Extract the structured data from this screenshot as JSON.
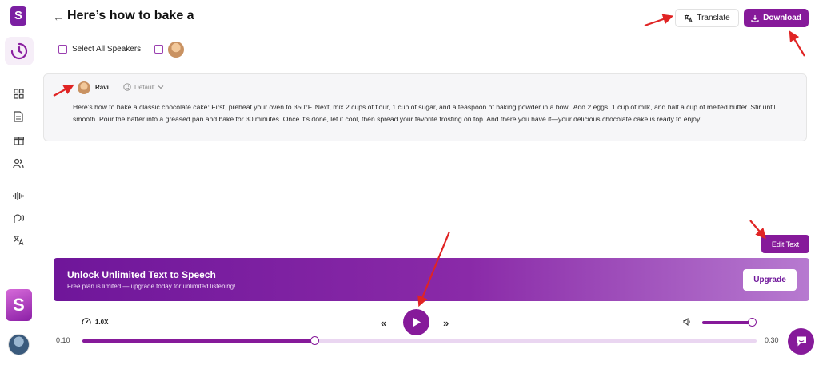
{
  "header": {
    "title": "Here’s how to bake a",
    "translate_label": "Translate",
    "download_label": "Download"
  },
  "speakers": {
    "select_all_label": "Select All Speakers"
  },
  "card": {
    "speaker_name": "Ravi",
    "voice_label": "Default",
    "text": "Here’s how to bake a classic chocolate cake: First, preheat your oven to 350°F. Next, mix 2 cups of flour, 1 cup of sugar, and a teaspoon of baking powder in a bowl. Add 2 eggs, 1 cup of milk, and half a cup of melted butter. Stir until smooth. Pour the batter into a greased pan and bake for 30 minutes. Once it’s done, let it cool, then spread your favorite frosting on top. And there you have it—your delicious chocolate cake is ready to enjoy!"
  },
  "edit_text_label": "Edit Text",
  "banner": {
    "title": "Unlock Unlimited Text to Speech",
    "subtitle": "Free plan is limited — upgrade today for unlimited listening!",
    "upgrade_label": "Upgrade"
  },
  "player": {
    "speed": "1.0X",
    "current_time": "0:10",
    "total_time": "0:30",
    "progress_fraction": 0.345,
    "volume_fraction": 1.0,
    "rewind_glyph": "«",
    "forward_glyph": "»"
  },
  "icons": {
    "brand_letter": "S"
  },
  "colors": {
    "accent": "#861a9a",
    "annotation_arrow": "#e02424"
  }
}
